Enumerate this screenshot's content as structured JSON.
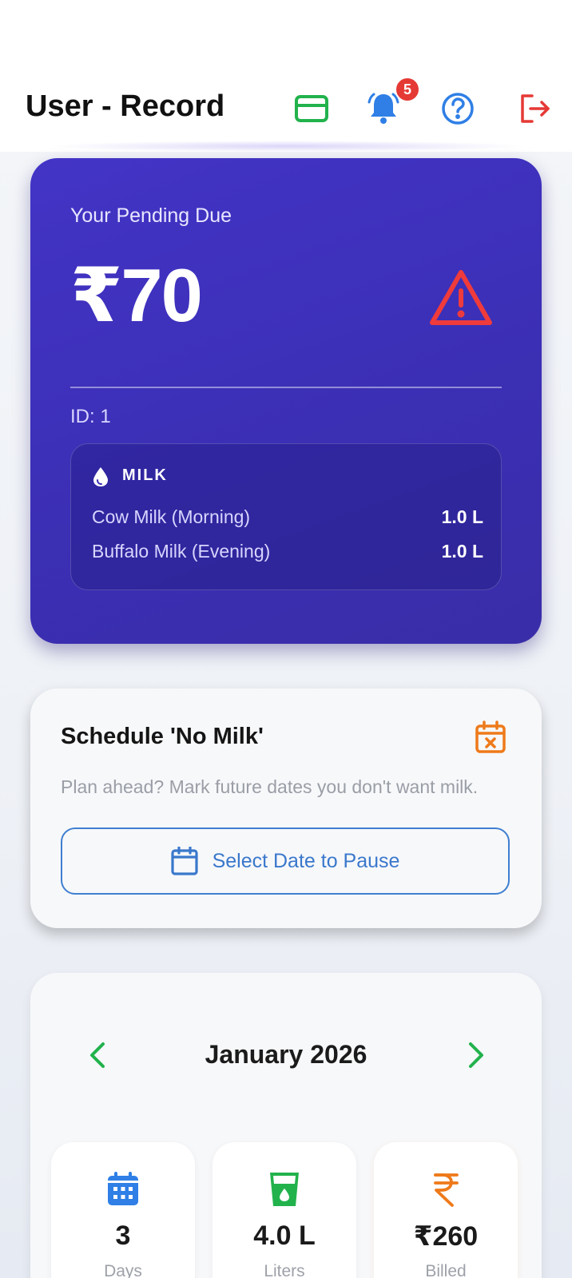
{
  "header": {
    "title": "User - Record",
    "notification_count": "5",
    "icons": [
      "card-icon",
      "bell-icon",
      "help-icon",
      "logout-icon"
    ]
  },
  "due_card": {
    "label": "Your Pending Due",
    "amount": "₹70",
    "id_text": "ID: 1",
    "milk": {
      "heading": "MILK",
      "items": [
        {
          "name": "Cow Milk (Morning)",
          "qty": "1.0 L"
        },
        {
          "name": "Buffalo Milk (Evening)",
          "qty": "1.0 L"
        }
      ]
    }
  },
  "schedule": {
    "title": "Schedule 'No Milk'",
    "subtitle": "Plan ahead? Mark future dates you don't want milk.",
    "button_label": "Select Date to Pause"
  },
  "month": {
    "title": "January 2026",
    "stats": [
      {
        "value": "3",
        "label": "Days"
      },
      {
        "value": "4.0 L",
        "label": "Liters"
      },
      {
        "value": "₹260",
        "label": "Billed"
      }
    ]
  },
  "colors": {
    "accent_purple": "#4334c6",
    "green": "#22b24c",
    "blue": "#2f7fe6",
    "red": "#e53935",
    "orange": "#ee7a1a"
  }
}
